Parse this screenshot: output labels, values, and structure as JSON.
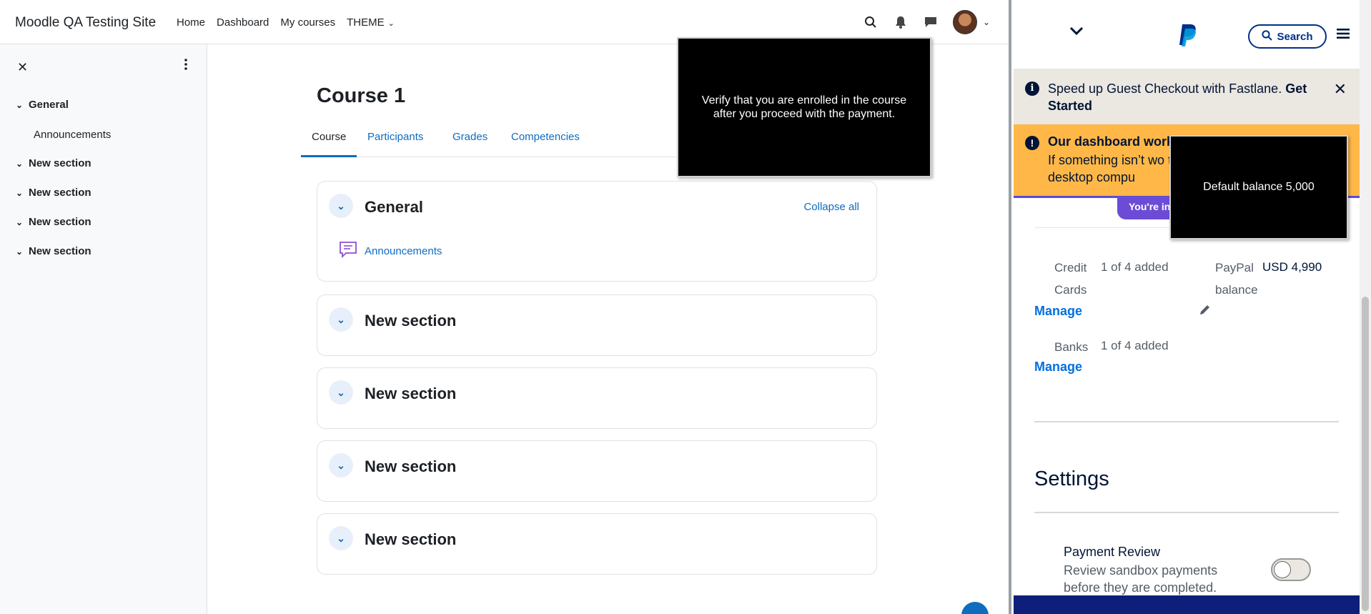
{
  "moodle": {
    "brand": "Moodle QA Testing Site",
    "nav": [
      "Home",
      "Dashboard",
      "My courses",
      "THEME"
    ],
    "drawer": {
      "sections": [
        "General",
        "New section",
        "New section",
        "New section",
        "New section"
      ],
      "sub_items": [
        "Announcements"
      ]
    },
    "course": {
      "title": "Course 1",
      "tabs": [
        "Course",
        "Participants",
        "Grades",
        "Competencies"
      ],
      "collapse_all": "Collapse all",
      "sections": [
        {
          "title": "General",
          "activity": "Announcements"
        },
        {
          "title": "New section"
        },
        {
          "title": "New section"
        },
        {
          "title": "New section"
        },
        {
          "title": "New section"
        }
      ]
    },
    "tooltip": "Verify that you are enrolled in the course after you proceed with the payment."
  },
  "paypal": {
    "search_label": "Search",
    "banner_info": {
      "text": "Speed up Guest Checkout with Fastlane.",
      "link": "Get Started"
    },
    "banner_warn": {
      "title": "Our dashboard work",
      "body": "If something isn’t wo to a desktop compu"
    },
    "pill": "You're in",
    "tooltip": "Default balance 5,000",
    "credit_cards": {
      "label1": "Credit",
      "label2": "Cards",
      "value": "1 of 4 added",
      "manage": "Manage"
    },
    "paypal_balance": {
      "label1": "PayPal",
      "label2": "balance",
      "value": "USD 4,990"
    },
    "banks": {
      "label": "Banks",
      "value": "1 of 4 added",
      "manage": "Manage"
    },
    "settings": {
      "title": "Settings",
      "payment_review": {
        "title": "Payment Review",
        "desc": "Review sandbox payments before they are completed.",
        "enabled": false
      }
    }
  },
  "colors": {
    "moodle_link": "#0f6cbf",
    "paypal_navy": "#003087",
    "warn": "#ffb847",
    "info": "#ebe7e1",
    "purple": "#6c4cd6"
  }
}
